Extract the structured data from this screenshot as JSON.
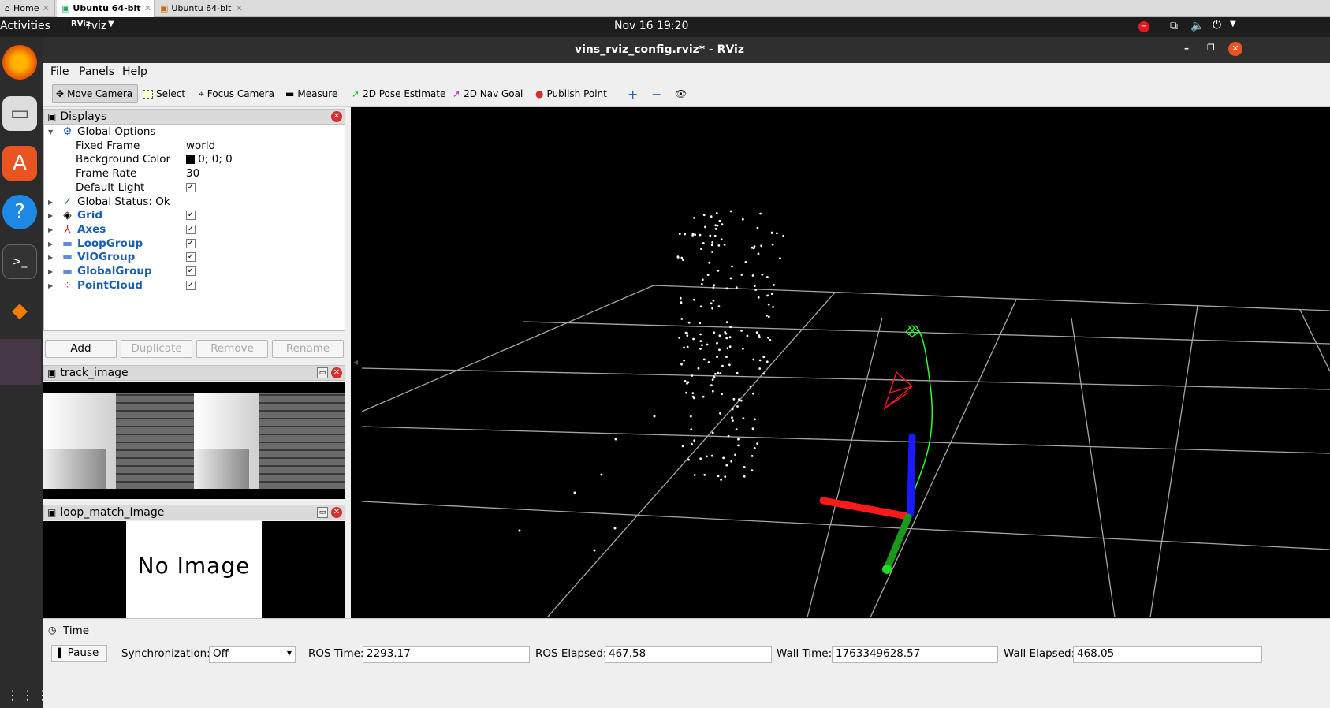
{
  "vm_tabs": [
    {
      "label": "Home"
    },
    {
      "label": "Ubuntu 64-bit"
    },
    {
      "label": "Ubuntu 64-bit"
    }
  ],
  "topbar": {
    "activities": "Activities",
    "app_name": "rviz",
    "datetime": "Nov 16  19:20"
  },
  "window": {
    "title": "vins_rviz_config.rviz* - RViz"
  },
  "menubar": {
    "file": "File",
    "panels": "Panels",
    "help": "Help"
  },
  "toolbar": {
    "move_camera": "Move Camera",
    "select": "Select",
    "focus_camera": "Focus Camera",
    "measure": "Measure",
    "pose_estimate": "2D Pose Estimate",
    "nav_goal": "2D Nav Goal",
    "publish_point": "Publish Point"
  },
  "displays": {
    "title": "Displays",
    "global_options": "Global Options",
    "fixed_frame_label": "Fixed Frame",
    "fixed_frame_value": "world",
    "background_color_label": "Background Color",
    "background_color_value": "0; 0; 0",
    "frame_rate_label": "Frame Rate",
    "frame_rate_value": "30",
    "default_light_label": "Default Light",
    "global_status": "Global Status: Ok",
    "items": [
      {
        "label": "Grid",
        "checked": true
      },
      {
        "label": "Axes",
        "checked": true
      },
      {
        "label": "LoopGroup",
        "checked": true
      },
      {
        "label": "VIOGroup",
        "checked": true
      },
      {
        "label": "GlobalGroup",
        "checked": true
      },
      {
        "label": "PointCloud",
        "checked": true
      }
    ],
    "buttons": {
      "add": "Add",
      "duplicate": "Duplicate",
      "remove": "Remove",
      "rename": "Rename"
    }
  },
  "track_image": {
    "title": "track_image"
  },
  "loop_match": {
    "title": "loop_match_Image",
    "no_image": "No Image"
  },
  "time": {
    "title": "Time",
    "pause": "Pause",
    "sync_label": "Synchronization:",
    "sync_value": "Off",
    "ros_time_label": "ROS Time:",
    "ros_time": "2293.17",
    "ros_elapsed_label": "ROS Elapsed:",
    "ros_elapsed": "467.58",
    "wall_time_label": "Wall Time:",
    "wall_time": "1763349628.57",
    "wall_elapsed_label": "Wall Elapsed:",
    "wall_elapsed": "468.05"
  }
}
